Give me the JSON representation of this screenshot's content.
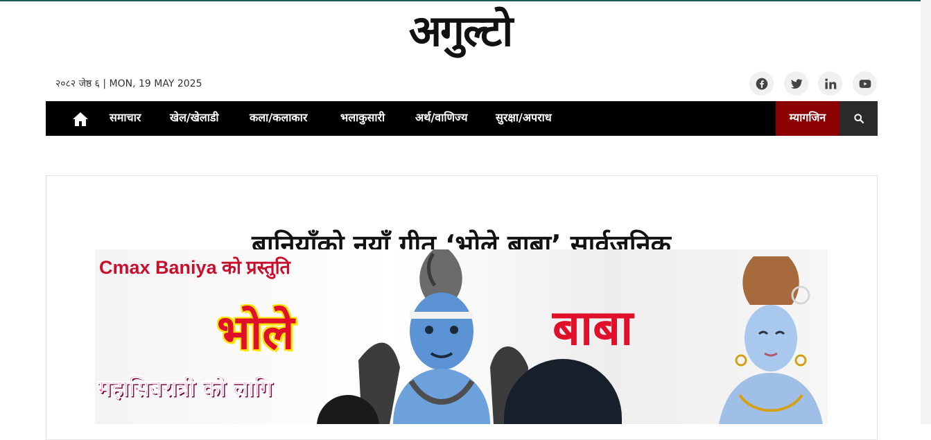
{
  "site": {
    "logo_text": "अगुल्टो",
    "dateline": "२०८२ जेष्ठ ६ | MON, 19 MAY 2025"
  },
  "social": [
    {
      "name": "facebook",
      "icon": "facebook-icon"
    },
    {
      "name": "twitter",
      "icon": "twitter-icon"
    },
    {
      "name": "linkedin",
      "icon": "linkedin-icon"
    },
    {
      "name": "youtube",
      "icon": "youtube-icon"
    }
  ],
  "nav": {
    "home_icon": "home-icon",
    "items": [
      "समाचार",
      "खेल/खेलाडी",
      "कला/कलाकार",
      "भलाकुसारी",
      "अर्थ/वाणिज्य",
      "सुरक्षा/अपराध"
    ],
    "magazine": "म्यागजिन",
    "search_icon": "search-icon"
  },
  "article": {
    "headline": "बानियाँको नयाँ गीत ‘भोले बाबा’ सार्वजनिक",
    "image": {
      "credit": "Cmax Baniya को प्रस्तुति",
      "title_left": "भोले",
      "title_right": "बाबा",
      "occasion": "महासिबरात्री को लागि"
    }
  },
  "colors": {
    "nav_bg": "#000000",
    "magazine_bg": "#8b0000",
    "search_bg": "#2a2a2a",
    "accent_red": "#e0102a"
  }
}
